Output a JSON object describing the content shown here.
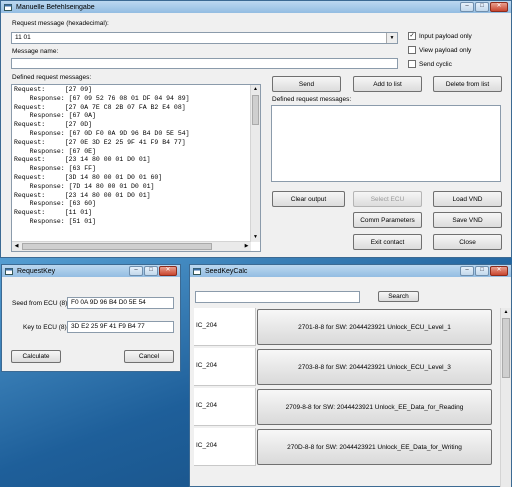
{
  "main_window": {
    "title": "Manuelle Befehlseingabe",
    "request_label": "Request message (hexadecimal):",
    "request_value": "11 01",
    "message_name_label": "Message name:",
    "message_name_value": "",
    "defined_label": "Defined request messages:",
    "checkboxes": [
      {
        "label": "Input payload only",
        "checked": true
      },
      {
        "label": "View payload only",
        "checked": false
      },
      {
        "label": "Send cyclic",
        "checked": false
      }
    ],
    "buttons": {
      "send": "Send",
      "add_to_list": "Add to list",
      "delete_from_list": "Delete from list",
      "clear_output": "Clear output",
      "select_ecu": "Select ECU",
      "load_vnd": "Load VND",
      "comm_parameters": "Comm Parameters",
      "save_vnd": "Save VND",
      "exit_contact": "Exit contact",
      "close": "Close"
    },
    "defined_list_label": "Defined request messages:",
    "output_lines": [
      "Request:     [27 09]",
      "    Response: [67 09 52 76 08 01 DF 04 94 89]",
      "Request:     [27 0A 7E C8 2B 07 FA B2 E4 08]",
      "    Response: [67 0A]",
      "Request:     [27 0D]",
      "    Response: [67 0D F0 0A 9D 96 B4 D0 5E 54]",
      "Request:     [27 0E 3D E2 25 9F 41 F9 B4 77]",
      "    Response: [67 0E]",
      "Request:     [23 14 80 00 01 D0 01]",
      "    Response: [63 FF]",
      "Request:     [3D 14 80 00 01 D0 01 60]",
      "    Response: [7D 14 80 00 01 D0 01]",
      "Request:     [23 14 80 00 01 D0 01]",
      "    Response: [63 60]",
      "Request:     [11 01]",
      "    Response: [51 01]"
    ]
  },
  "requestkey_window": {
    "title": "RequestKey",
    "seed_label": "Seed from ECU (8)",
    "seed_value": "F0 0A 9D 96 B4 D0 5E 54",
    "key_label": "Key to ECU (8)",
    "key_value": "3D E2 25 9F 41 F9 B4 77",
    "calculate": "Calculate",
    "cancel": "Cancel"
  },
  "seedkey_window": {
    "title": "SeedKeyCalc",
    "search_value": "",
    "search_button": "Search",
    "rows": [
      {
        "id": "IC_204",
        "action": "2701-8-8 for SW: 2044423921 Unlock_ECU_Level_1"
      },
      {
        "id": "IC_204",
        "action": "2703-8-8 for SW: 2044423921 Unlock_ECU_Level_3"
      },
      {
        "id": "IC_204",
        "action": "2709-8-8 for SW: 2044423921 Unlock_EE_Data_for_Reading"
      },
      {
        "id": "IC_204",
        "action": "270D-8-8 for SW: 2044423921 Unlock_EE_Data_for_Writing"
      }
    ]
  },
  "colors": {
    "titlebar": "#93bde2",
    "desktop": "#2a7fc0",
    "close_button": "#c9452f"
  },
  "icons": [
    "window-icon",
    "dropdown-arrow-icon",
    "minimize-icon",
    "maximize-icon",
    "close-icon",
    "scroll-up-icon",
    "scroll-down-icon",
    "scroll-left-icon",
    "scroll-right-icon"
  ]
}
